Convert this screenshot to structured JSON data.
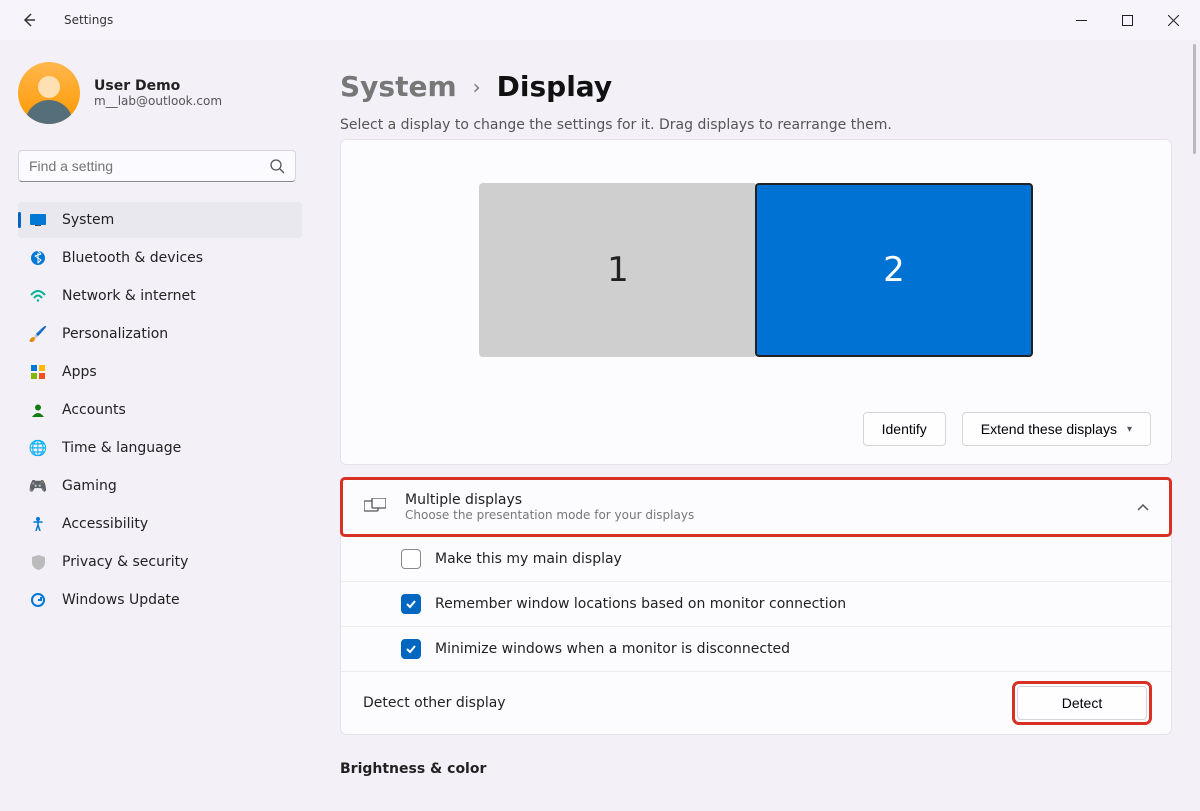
{
  "app_title": "Settings",
  "user": {
    "name": "User Demo",
    "email": "m__lab@outlook.com"
  },
  "search": {
    "placeholder": "Find a setting"
  },
  "sidebar": {
    "items": [
      {
        "label": "System",
        "icon": "🖥️",
        "active": true
      },
      {
        "label": "Bluetooth & devices",
        "icon": "bt"
      },
      {
        "label": "Network & internet",
        "icon": "📶"
      },
      {
        "label": "Personalization",
        "icon": "🖌️"
      },
      {
        "label": "Apps",
        "icon": "🔲"
      },
      {
        "label": "Accounts",
        "icon": "👤"
      },
      {
        "label": "Time & language",
        "icon": "🌐"
      },
      {
        "label": "Gaming",
        "icon": "🎮"
      },
      {
        "label": "Accessibility",
        "icon": "🚶"
      },
      {
        "label": "Privacy & security",
        "icon": "🛡️"
      },
      {
        "label": "Windows Update",
        "icon": "🔄"
      }
    ]
  },
  "breadcrumb": {
    "parent": "System",
    "current": "Display"
  },
  "helper_text": "Select a display to change the settings for it. Drag displays to rearrange them.",
  "displays": {
    "d1": "1",
    "d2": "2"
  },
  "actions": {
    "identify": "Identify",
    "extend": "Extend these displays"
  },
  "multi": {
    "title": "Multiple displays",
    "subtitle": "Choose the presentation mode for your displays",
    "rows": {
      "main": "Make this my main display",
      "remember": "Remember window locations based on monitor connection",
      "minimize": "Minimize windows when a monitor is disconnected",
      "detect_label": "Detect other display",
      "detect_btn": "Detect"
    }
  },
  "brightness_section": "Brightness & color"
}
